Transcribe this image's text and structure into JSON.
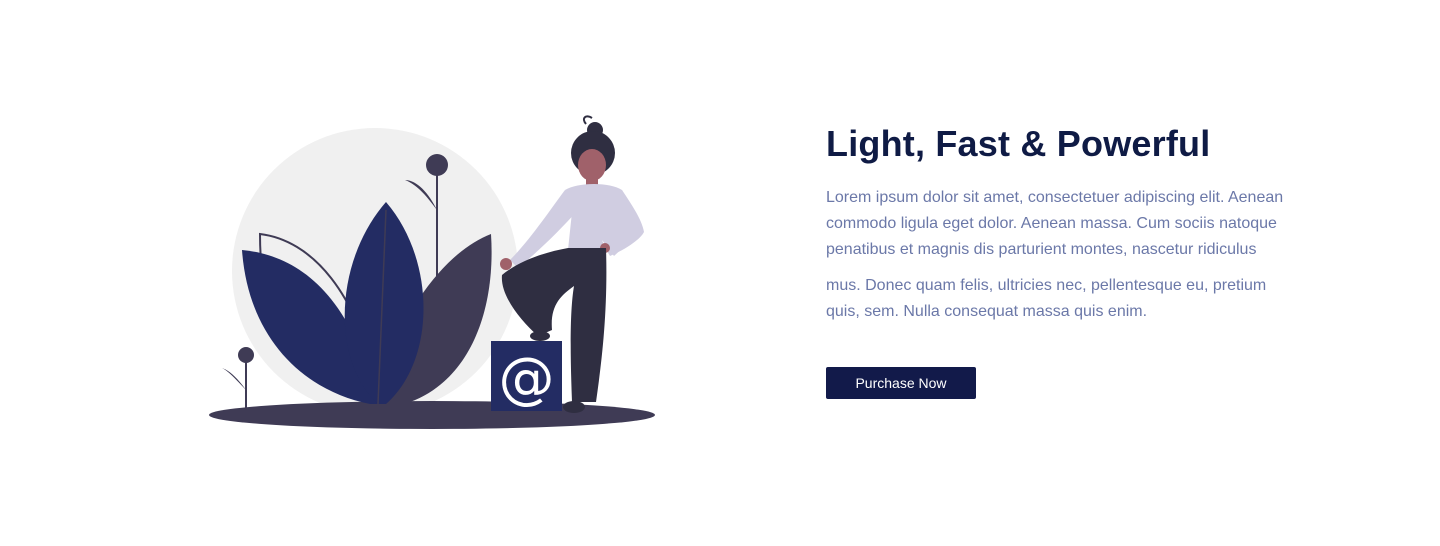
{
  "feature": {
    "title": "Light, Fast & Powerful",
    "paragraph_1": "Lorem ipsum dolor sit amet, consectetuer adipiscing elit. Aenean commodo ligula eget dolor. Aenean massa. Cum sociis natoque penatibus et magnis dis parturient montes, nascetur ridiculus",
    "paragraph_2": "mus. Donec quam felis, ultricies nec, pellentesque eu, pretium quis, sem. Nulla consequat massa quis enim.",
    "cta_label": "Purchase Now"
  },
  "illustration": {
    "box_symbol": "@",
    "icons": [
      "leaf-plant",
      "at-sign-box",
      "woman-figure"
    ]
  },
  "colors": {
    "heading": "#0f1b45",
    "body_text": "#6b78a8",
    "button_bg": "#121a4a",
    "accent_navy": "#232c63",
    "dark_leaf": "#3f3b55",
    "circle_bg": "#f0f0f0"
  }
}
